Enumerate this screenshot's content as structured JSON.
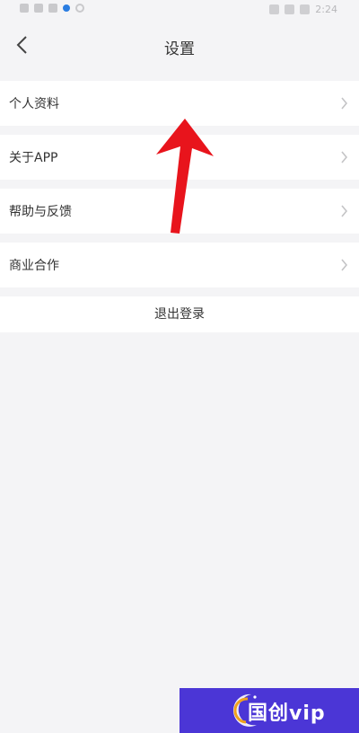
{
  "status_bar": {
    "time": "2:24"
  },
  "header": {
    "title": "设置"
  },
  "settings": {
    "items": [
      {
        "label": "个人资料"
      },
      {
        "label": "关于APP"
      },
      {
        "label": "帮助与反馈"
      },
      {
        "label": "商业合作"
      }
    ],
    "logout_label": "退出登录"
  },
  "watermark": {
    "text": "国创vip"
  },
  "colors": {
    "background": "#f4f4f6",
    "card": "#ffffff",
    "arrow": "#e8141c",
    "watermark_bg": "#4b36d6"
  }
}
